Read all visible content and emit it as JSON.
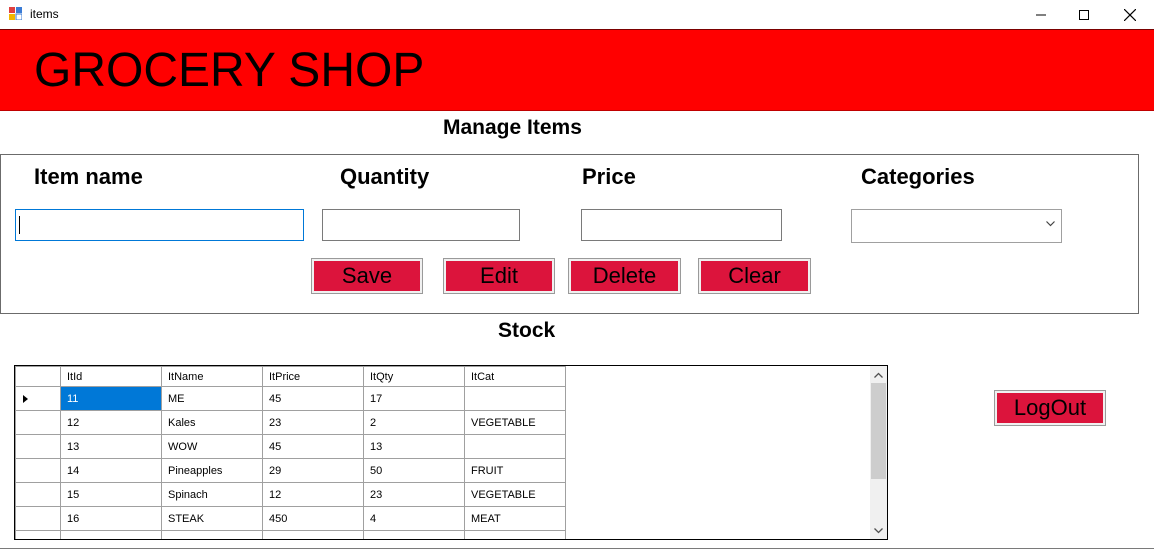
{
  "window": {
    "title": "items",
    "buttons": [
      "minimize",
      "maximize",
      "close"
    ]
  },
  "header": {
    "title": "GROCERY SHOP",
    "color": "#ff0000"
  },
  "manage": {
    "title": "Manage Items",
    "labels": {
      "item_name": "Item name",
      "quantity": "Quantity",
      "price": "Price",
      "categories": "Categories"
    },
    "values": {
      "item_name": "",
      "quantity": "",
      "price": "",
      "categories": ""
    },
    "buttons": {
      "save": "Save",
      "edit": "Edit",
      "delete": "Delete",
      "clear": "Clear"
    },
    "button_color": "#dc143c"
  },
  "stock": {
    "title": "Stock",
    "columns": [
      "ItId",
      "ItName",
      "ItPrice",
      "ItQty",
      "ItCat"
    ],
    "rows": [
      [
        "11",
        "ME",
        "45",
        "17",
        ""
      ],
      [
        "12",
        "Kales",
        "23",
        "2",
        "VEGETABLE"
      ],
      [
        "13",
        "WOW",
        "45",
        "13",
        ""
      ],
      [
        "14",
        "Pineapples",
        "29",
        "50",
        "FRUIT"
      ],
      [
        "15",
        "Spinach",
        "12",
        "23",
        "VEGETABLE"
      ],
      [
        "16",
        "STEAK",
        "450",
        "4",
        "MEAT"
      ]
    ],
    "selected_row": 0
  },
  "logout": {
    "label": "LogOut"
  }
}
